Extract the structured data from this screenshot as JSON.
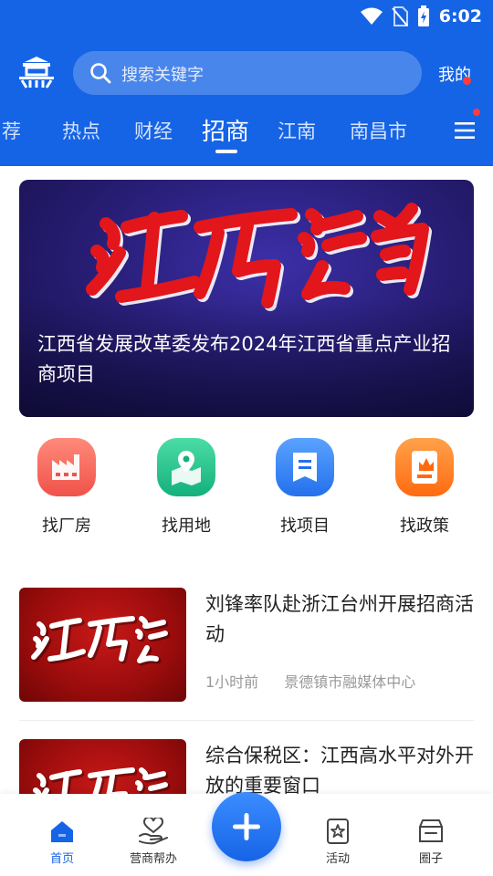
{
  "status_bar": {
    "time": "6:02"
  },
  "header": {
    "search_placeholder": "搜索关键字",
    "mine_label": "我的"
  },
  "tabs": [
    {
      "label": "荐"
    },
    {
      "label": "热点"
    },
    {
      "label": "财经"
    },
    {
      "label": "招商",
      "active": true
    },
    {
      "label": "江南"
    },
    {
      "label": "南昌市"
    }
  ],
  "banner": {
    "art_text": "江西招商",
    "title": "江西省发展改革委发布2024年江西省重点产业招商项目"
  },
  "quick_links": [
    {
      "label": "找厂房",
      "icon": "factory-icon",
      "color": "#f0524a"
    },
    {
      "label": "找用地",
      "icon": "map-pin-icon",
      "color": "#18c08a"
    },
    {
      "label": "找项目",
      "icon": "document-icon",
      "color": "#2a7cf0"
    },
    {
      "label": "找政策",
      "icon": "policy-icon",
      "color": "#ff7a1a"
    }
  ],
  "news": [
    {
      "thumb_text": "江西招商",
      "title": "刘锋率队赴浙江台州开展招商活动",
      "time": "1小时前",
      "source": "景德镇市融媒体中心"
    },
    {
      "thumb_text": "江西招商",
      "title": "综合保税区：江西高水平对外开放的重要窗口",
      "time": "",
      "source": ""
    }
  ],
  "bottom_nav": {
    "home": "首页",
    "business": "营商帮办",
    "activity": "活动",
    "circle": "圈子"
  },
  "colors": {
    "brand_blue": "#1664e6",
    "badge_red": "#ff3b3b"
  }
}
